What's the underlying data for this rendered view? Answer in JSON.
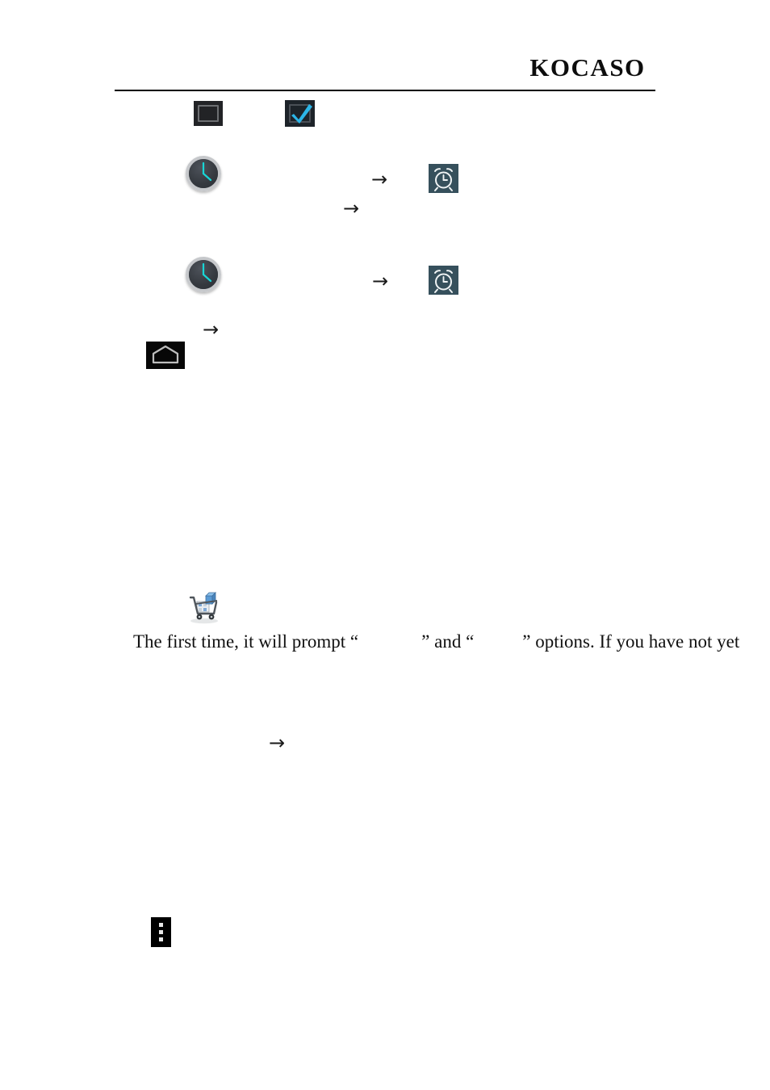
{
  "document": {
    "brand": "KOCASO",
    "page_background": "#ffffff",
    "rule_color": "#000000"
  },
  "icons": {
    "checkbox_unchecked": {
      "name": "checkbox-unchecked-icon",
      "background": "#222326",
      "border": "#6d6f72"
    },
    "checkbox_checked": {
      "name": "checkbox-checked-icon",
      "background": "#1d2329",
      "check_color": "#29b6e8"
    },
    "clock_analog": {
      "name": "analog-clock-icon",
      "bezel": "#c6c8cb",
      "face": "#33383e",
      "hands": "#16d8d8"
    },
    "alarm_clock": {
      "name": "alarm-clock-icon",
      "background": "#36505c",
      "glyph": "#eef2f3"
    },
    "home": {
      "name": "home-icon",
      "background": "#070707",
      "glyph": "#b9b9b9"
    },
    "overflow_menu": {
      "name": "overflow-menu-icon",
      "background": "#000000",
      "dots": "#e8e8e8"
    },
    "market_cart": {
      "name": "market-cart-icon",
      "cart_color": "#4a4f55",
      "item_color": "#5b9bd5"
    }
  },
  "arrows": {
    "glyph": "→",
    "a1_label": "step-arrow",
    "a2_label": "step-arrow",
    "a3_label": "step-arrow",
    "a4_label": "step-arrow",
    "a5_label": "step-arrow"
  },
  "content": {
    "paragraph_1": {
      "part_1": "The first time, it will prompt “",
      "gap_1": "",
      "part_2": "” and “",
      "gap_2": "",
      "part_3": "” options. If you have not yet"
    }
  }
}
